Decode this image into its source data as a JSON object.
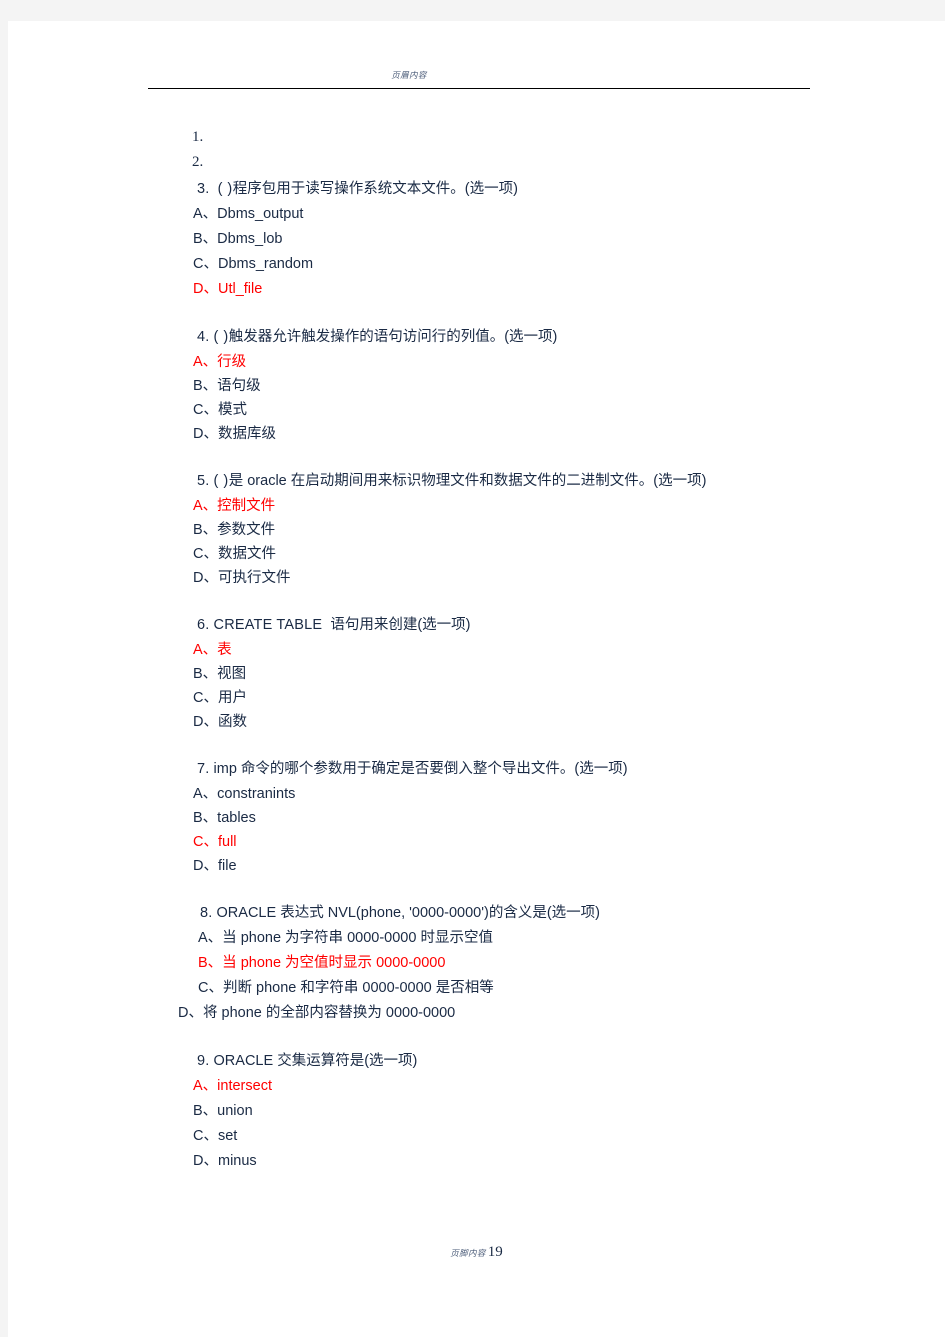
{
  "page": {
    "header_text": "页眉内容",
    "footer_text": "页脚内容",
    "page_number": "19",
    "answer_color": "#ff0000",
    "text_color": "#1a2a44"
  },
  "empty_items": [
    {
      "number": "1."
    },
    {
      "number": "2."
    }
  ],
  "questions": [
    {
      "id": "q3",
      "number": "3.",
      "blank": "(    )",
      "text": "程序包用于读写操作系统文本文件。(选一项)",
      "options": [
        {
          "label": "A、",
          "text": "Dbms_output",
          "answer": false
        },
        {
          "label": "B、",
          "text": "Dbms_lob",
          "answer": false
        },
        {
          "label": "C、",
          "text": "Dbms_random",
          "answer": false
        },
        {
          "label": "D、",
          "text": "Utl_file",
          "answer": true
        }
      ]
    },
    {
      "id": "q4",
      "number": "4.",
      "blank": "(    )",
      "text": "触发器允许触发操作的语句访问行的列值。(选一项)",
      "options": [
        {
          "label": "A、",
          "text": "行级",
          "answer": true
        },
        {
          "label": "B、",
          "text": "语句级",
          "answer": false
        },
        {
          "label": "C、",
          "text": "模式",
          "answer": false
        },
        {
          "label": "D、",
          "text": "数据库级",
          "answer": false
        }
      ]
    },
    {
      "id": "q5",
      "number": "5.",
      "blank": "(    )",
      "text": "是 oracle 在启动期间用来标识物理文件和数据文件的二进制文件。(选一项)",
      "options": [
        {
          "label": "A、",
          "text": "控制文件",
          "answer": true
        },
        {
          "label": "B、",
          "text": "参数文件",
          "answer": false
        },
        {
          "label": "C、",
          "text": "数据文件",
          "answer": false
        },
        {
          "label": "D、",
          "text": "可执行文件",
          "answer": false
        }
      ]
    },
    {
      "id": "q6",
      "number": "6.",
      "keyword": "CREATE TABLE",
      "text": "语句用来创建(选一项)",
      "options": [
        {
          "label": "A、",
          "text": "表",
          "answer": true
        },
        {
          "label": "B、",
          "text": "视图",
          "answer": false
        },
        {
          "label": "C、",
          "text": "用户",
          "answer": false
        },
        {
          "label": "D、",
          "text": "函数",
          "answer": false
        }
      ]
    },
    {
      "id": "q7",
      "number": "7.",
      "text": "imp 命令的哪个参数用于确定是否要倒入整个导出文件。(选一项)",
      "options": [
        {
          "label": "A、",
          "text": "constranints",
          "answer": false
        },
        {
          "label": "B、",
          "text": "tables",
          "answer": false
        },
        {
          "label": "C、",
          "text": "full",
          "answer": true
        },
        {
          "label": "D、",
          "text": "file",
          "answer": false
        }
      ]
    },
    {
      "id": "q8",
      "number": "8.",
      "text": "ORACLE 表达式 NVL(phone,  '0000-0000')的含义是(选一项)",
      "options": [
        {
          "label": "A、",
          "text": "当 phone 为字符串 0000-0000 时显示空值",
          "answer": false
        },
        {
          "label": "B、",
          "text": "当 phone 为空值时显示 0000-0000",
          "answer": true
        },
        {
          "label": "C、",
          "text": "判断 phone 和字符串 0000-0000 是否相等",
          "answer": false
        },
        {
          "label": "D、",
          "text": "将 phone 的全部内容替换为 0000-0000",
          "answer": false,
          "outdent": true
        }
      ]
    },
    {
      "id": "q9",
      "number": "9.",
      "text": "ORACLE 交集运算符是(选一项)",
      "options": [
        {
          "label": "A、",
          "text": "intersect",
          "answer": true
        },
        {
          "label": "B、",
          "text": "union",
          "answer": false
        },
        {
          "label": "C、",
          "text": "set",
          "answer": false
        },
        {
          "label": "D、",
          "text": "minus",
          "answer": false
        }
      ]
    }
  ]
}
